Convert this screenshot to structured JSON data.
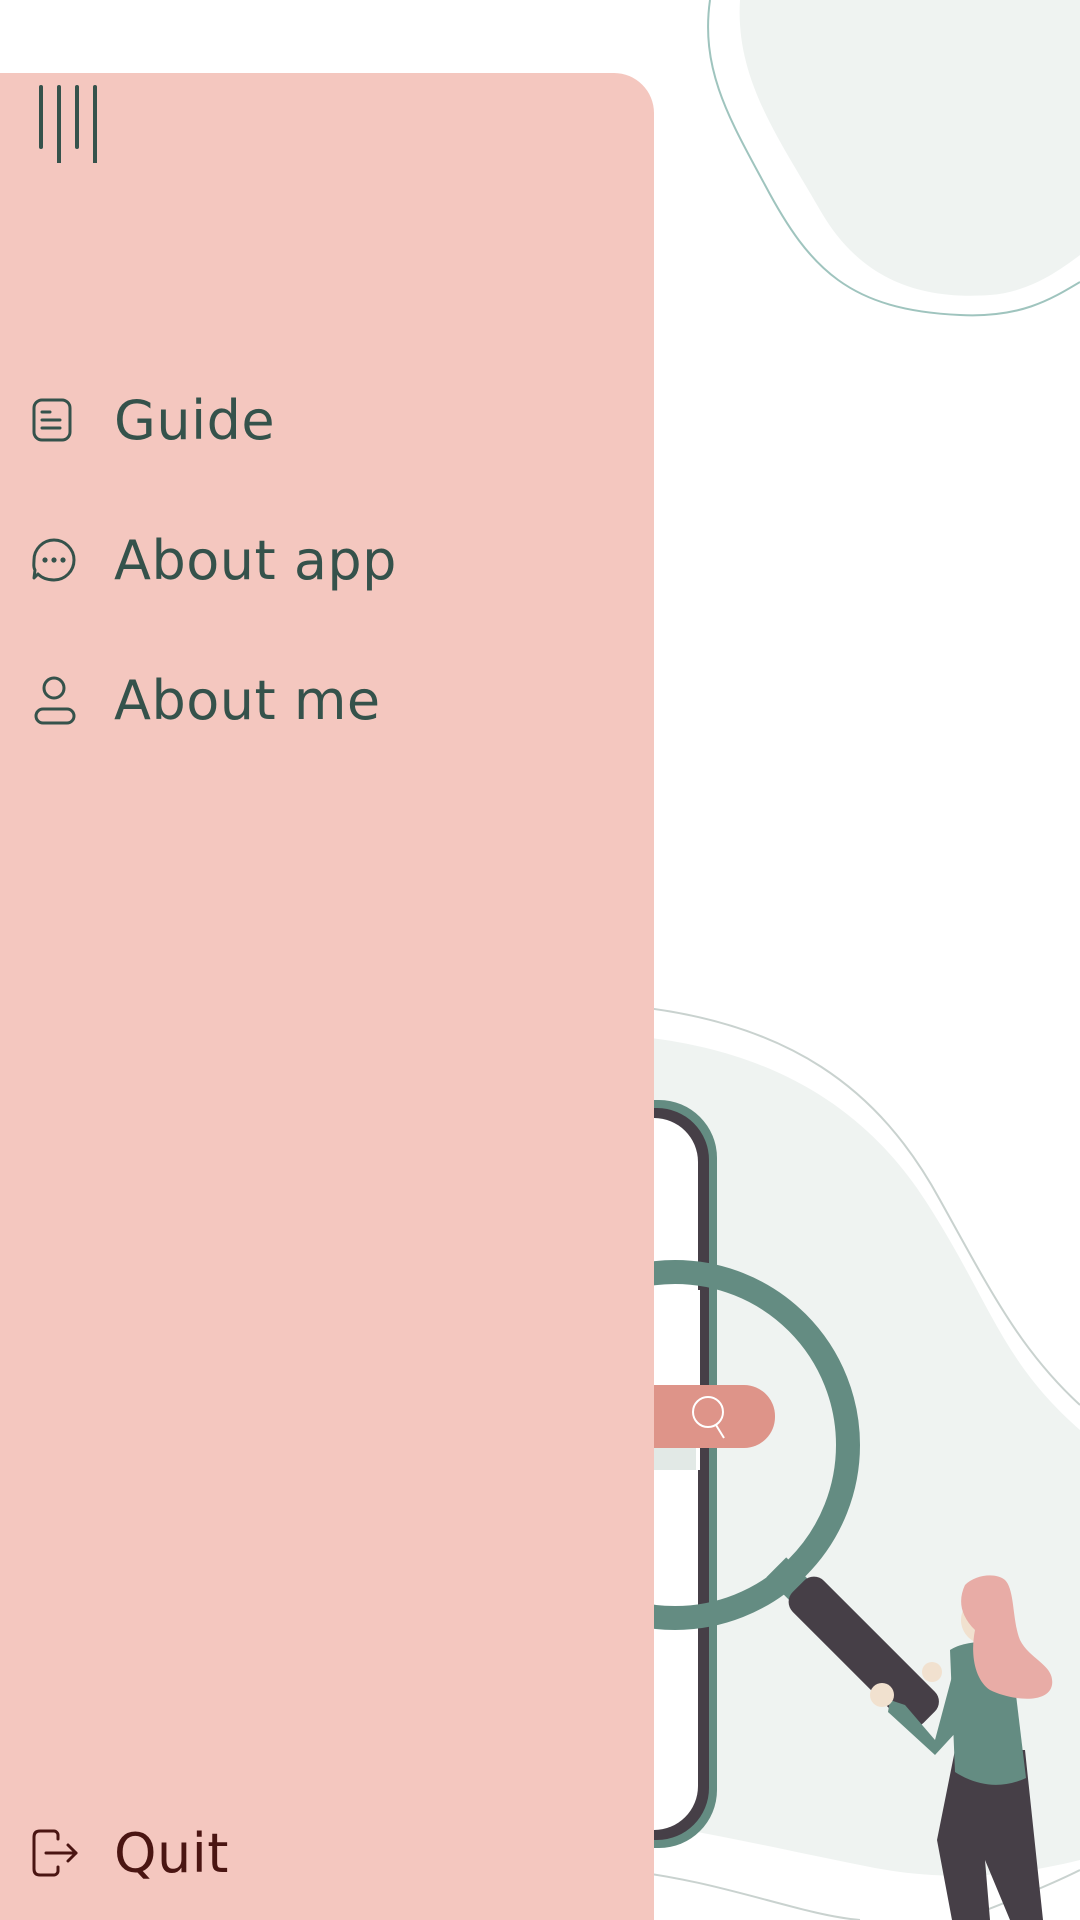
{
  "colors": {
    "drawer_bg": "#f4c7bf",
    "menu_text": "#35524b",
    "quit_text": "#4a1512",
    "accent_green": "#648c82",
    "dark": "#463f47",
    "search_pill": "#de9489",
    "blob_fill": "#eff3f1",
    "hair": "#e8aca6"
  },
  "drawer": {
    "toggle_icon": "vertical-bars-icon",
    "items": [
      {
        "label": "Guide",
        "icon": "document-icon"
      },
      {
        "label": "About app",
        "icon": "chat-bubble-icon"
      },
      {
        "label": "About me",
        "icon": "person-icon"
      }
    ],
    "quit": {
      "label": "Quit",
      "icon": "logout-icon"
    }
  },
  "illustration": {
    "subject": "woman-holding-magnifier-over-phone",
    "search_icon": "search-icon"
  }
}
